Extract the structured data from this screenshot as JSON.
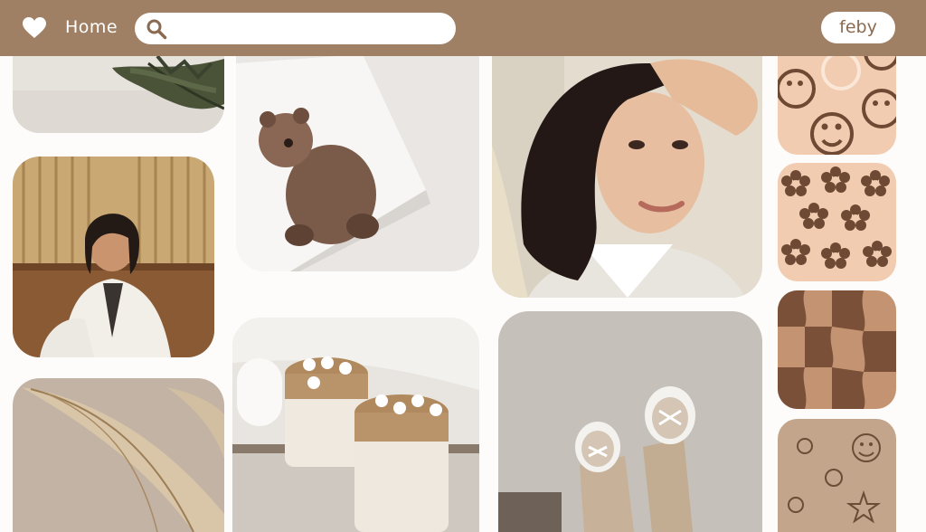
{
  "nav": {
    "home_label": "Home",
    "search_placeholder": "",
    "search_value": "",
    "user_name": "feby"
  },
  "colors": {
    "topbar": "#a08064",
    "background": "#fdfcfb",
    "accent_light": "#f2d3bb",
    "accent_dark": "#8a6246"
  },
  "icons": {
    "logo": "heart-icon",
    "search": "search-icon"
  },
  "gallery": {
    "tiles": [
      {
        "name": "leaves-photo"
      },
      {
        "name": "bear-painting-photo"
      },
      {
        "name": "girl-portrait-photo"
      },
      {
        "name": "smiley-pattern"
      },
      {
        "name": "woman-bamboo-photo"
      },
      {
        "name": "flower-pattern"
      },
      {
        "name": "fairy-wings-photo"
      },
      {
        "name": "candles-photo"
      },
      {
        "name": "sneakers-photo"
      },
      {
        "name": "checker-wave-pattern"
      },
      {
        "name": "doodle-pattern"
      }
    ]
  }
}
